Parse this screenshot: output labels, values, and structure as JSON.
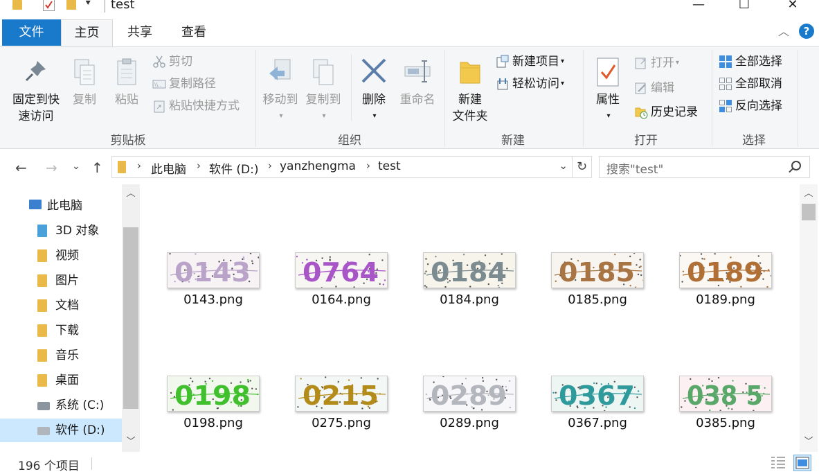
{
  "window": {
    "title": "test",
    "controls": {
      "minimize": "—",
      "maximize": "☐",
      "close": "✕"
    }
  },
  "tabs": {
    "file": "文件",
    "home": "主页",
    "share": "共享",
    "view": "查看",
    "help": "?"
  },
  "ribbon": {
    "clipboard": {
      "label": "剪贴板",
      "pin": "固定到快\n速访问",
      "pin_l1": "固定到快",
      "pin_l2": "速访问",
      "copy": "复制",
      "paste": "粘贴",
      "cut": "剪切",
      "copy_path": "复制路径",
      "paste_shortcut": "粘贴快捷方式"
    },
    "organize": {
      "label": "组织",
      "move_to": "移动到",
      "copy_to": "复制到",
      "delete": "删除",
      "rename": "重命名"
    },
    "new": {
      "label": "新建",
      "new_folder_l1": "新建",
      "new_folder_l2": "文件夹",
      "new_item": "新建项目",
      "easy_access": "轻松访问"
    },
    "open": {
      "label": "打开",
      "properties": "属性",
      "open": "打开",
      "edit": "编辑",
      "history": "历史记录"
    },
    "select": {
      "label": "选择",
      "select_all": "全部选择",
      "select_none": "全部取消",
      "invert": "反向选择"
    }
  },
  "address": {
    "breadcrumbs": [
      "此电脑",
      "软件 (D:)",
      "yanzhengma",
      "test"
    ],
    "search_placeholder": "搜索\"test\""
  },
  "nav": {
    "items": [
      {
        "label": "此电脑",
        "icon": "computer-icon"
      },
      {
        "label": "3D 对象",
        "icon": "3d-objects-icon"
      },
      {
        "label": "视频",
        "icon": "video-folder-icon"
      },
      {
        "label": "图片",
        "icon": "pictures-folder-icon"
      },
      {
        "label": "文档",
        "icon": "documents-folder-icon"
      },
      {
        "label": "下载",
        "icon": "downloads-folder-icon"
      },
      {
        "label": "音乐",
        "icon": "music-folder-icon"
      },
      {
        "label": "桌面",
        "icon": "desktop-folder-icon"
      },
      {
        "label": "系统 (C:)",
        "icon": "drive-c-icon"
      },
      {
        "label": "软件 (D:)",
        "icon": "drive-d-icon"
      }
    ],
    "selected_index": 9
  },
  "files": [
    {
      "name": "0143.png",
      "captcha": "0143",
      "color": "#b9a3c9",
      "bg": "#f7f3f5"
    },
    {
      "name": "0164.png",
      "captcha": "0764",
      "color": "#a855c8",
      "bg": "#f8f6f2"
    },
    {
      "name": "0184.png",
      "captcha": "0184",
      "color": "#7b8b90",
      "bg": "#f7f4ec"
    },
    {
      "name": "0185.png",
      "captcha": "0185",
      "color": "#a87443",
      "bg": "#f8f5f0"
    },
    {
      "name": "0189.png",
      "captcha": "0189",
      "color": "#b06f35",
      "bg": "#fbf7f3"
    },
    {
      "name": "0198.png",
      "captcha": "0198",
      "color": "#3fc02c",
      "bg": "#f3f8ef"
    },
    {
      "name": "0275.png",
      "captcha": "0215",
      "color": "#b38b1a",
      "bg": "#f3f8f6"
    },
    {
      "name": "0289.png",
      "captcha": "0289",
      "color": "#b4b6bd",
      "bg": "#f7f7f9"
    },
    {
      "name": "0367.png",
      "captcha": "0367",
      "color": "#2e9a9c",
      "bg": "#eef6f3"
    },
    {
      "name": "0385.png",
      "captcha": "038 5",
      "color": "#5aa76a",
      "bg": "#fdf0f2"
    }
  ],
  "status": {
    "item_count": "196 个项目"
  }
}
